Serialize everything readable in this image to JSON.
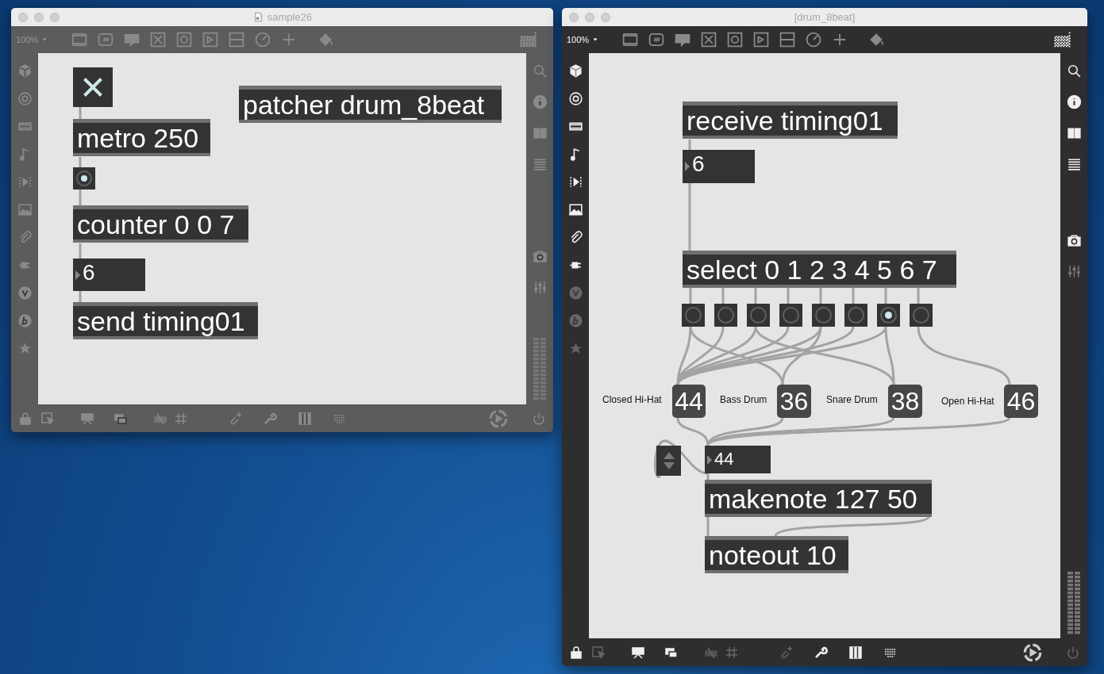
{
  "windows": [
    {
      "title": "sample26",
      "active": false,
      "zoom": "100%",
      "objects": [
        {
          "kind": "toggle",
          "checked": true
        },
        {
          "kind": "object",
          "text": "patcher drum_8beat"
        },
        {
          "kind": "object",
          "text": "metro 250"
        },
        {
          "kind": "bang",
          "on": true
        },
        {
          "kind": "object",
          "text": "counter 0 0 7"
        },
        {
          "kind": "number",
          "value": "6"
        },
        {
          "kind": "object",
          "text": "send timing01"
        }
      ]
    },
    {
      "title": "[drum_8beat]",
      "active": true,
      "zoom": "100%",
      "objects": [
        {
          "kind": "object",
          "text": "receive timing01"
        },
        {
          "kind": "number",
          "value": "6"
        },
        {
          "kind": "object",
          "text": "select 0 1 2 3 4 5 6 7"
        },
        {
          "kind": "bang",
          "on": false
        },
        {
          "kind": "bang",
          "on": false
        },
        {
          "kind": "bang",
          "on": false
        },
        {
          "kind": "bang",
          "on": false
        },
        {
          "kind": "bang",
          "on": false
        },
        {
          "kind": "bang",
          "on": false
        },
        {
          "kind": "bang",
          "on": true
        },
        {
          "kind": "bang",
          "on": false
        },
        {
          "kind": "comment",
          "text": "Closed Hi-Hat"
        },
        {
          "kind": "message",
          "text": "44"
        },
        {
          "kind": "comment",
          "text": "Bass Drum"
        },
        {
          "kind": "message",
          "text": "36"
        },
        {
          "kind": "comment",
          "text": "Snare Drum"
        },
        {
          "kind": "message",
          "text": "38"
        },
        {
          "kind": "comment",
          "text": "Open Hi-Hat"
        },
        {
          "kind": "message",
          "text": "46"
        },
        {
          "kind": "arrows"
        },
        {
          "kind": "number",
          "value": "44"
        },
        {
          "kind": "object",
          "text": "makenote 127 50"
        },
        {
          "kind": "object",
          "text": "noteout 10"
        }
      ]
    }
  ]
}
